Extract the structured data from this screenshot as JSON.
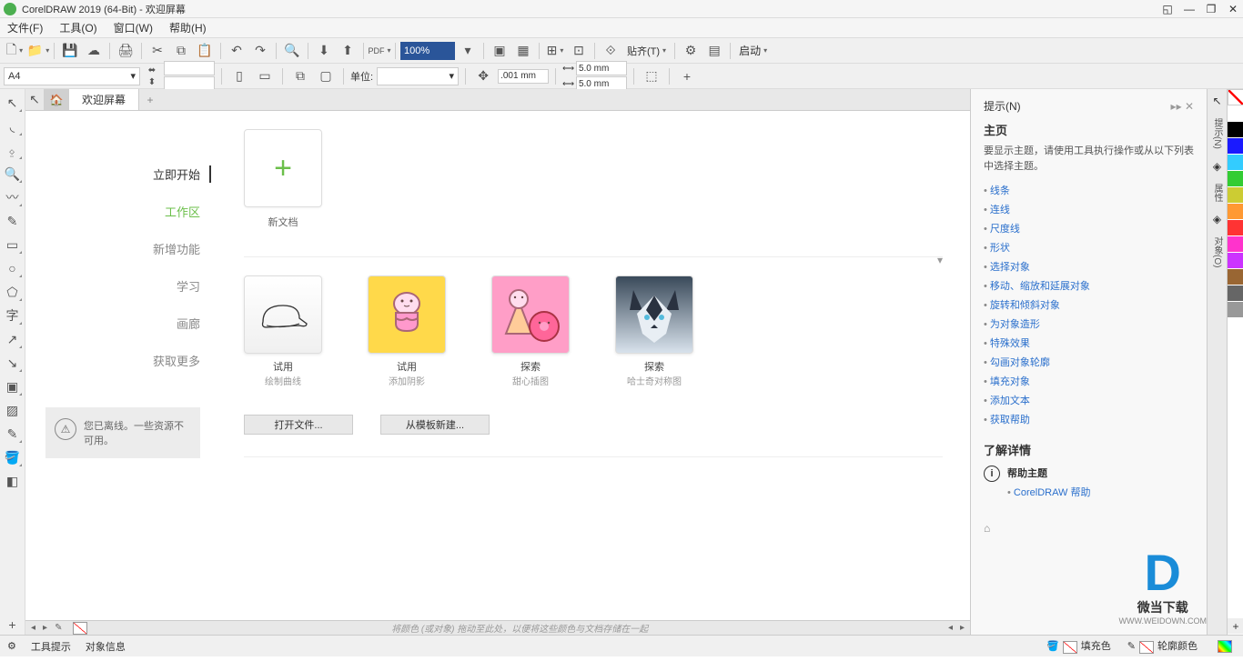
{
  "title": "CorelDRAW 2019 (64-Bit) - 欢迎屏幕",
  "menu": {
    "file": "文件(F)",
    "tools": "工具(O)",
    "window": "窗口(W)",
    "help": "帮助(H)"
  },
  "toolbar": {
    "zoom": "100%",
    "paste": "贴齐(T)",
    "launch": "启动"
  },
  "propbar": {
    "paper": "A4",
    "units": "单位:",
    "measure": ".001 mm",
    "nudge1": "5.0 mm",
    "nudge2": "5.0 mm"
  },
  "tabs": {
    "welcome": "欢迎屏幕"
  },
  "welcome": {
    "nav": {
      "start": "立即开始",
      "workspace": "工作区",
      "whatsnew": "新增功能",
      "learn": "学习",
      "gallery": "画廊",
      "getmore": "获取更多"
    },
    "offline": "您已离线。一些资源不可用。",
    "newdoc": "新文档",
    "thumbs": [
      {
        "t": "试用",
        "s": "绘制曲线"
      },
      {
        "t": "试用",
        "s": "添加阴影"
      },
      {
        "t": "探索",
        "s": "甜心插图"
      },
      {
        "t": "探索",
        "s": "哈士奇对称图"
      }
    ],
    "open": "打开文件...",
    "newtpl": "从模板新建...",
    "hint": "将颜色 (或对象) 拖动至此处，以便将这些颜色与文档存储在一起"
  },
  "hints": {
    "panel": "提示(N)",
    "title": "主页",
    "desc": "要显示主题，请使用工具执行操作或从以下列表中选择主题。",
    "links": [
      "线条",
      "连线",
      "尺度线",
      "形状",
      "选择对象",
      "移动、缩放和延展对象",
      "旋转和倾斜对象",
      "为对象造形",
      "特殊效果",
      "勾画对象轮廓",
      "填充对象",
      "添加文本",
      "获取帮助"
    ],
    "more": "了解详情",
    "helptopic": "帮助主题",
    "helplink": "CorelDRAW 帮助",
    "sidetabs": [
      "提示(N)",
      "属性",
      "对象(O)"
    ]
  },
  "status": {
    "tooltips": "工具提示",
    "objinfo": "对象信息",
    "fill": "填充色",
    "outline": "轮廓颜色"
  },
  "colors": [
    "#ffffff",
    "#000000",
    "#1a1aff",
    "#33ccff",
    "#33cc33",
    "#cccc33",
    "#ff9933",
    "#ff3333",
    "#ff33cc",
    "#cc33ff",
    "#996633",
    "#666666",
    "#999999"
  ],
  "watermark": {
    "logo": "D",
    "text": "微当下载",
    "url": "WWW.WEIDOWN.COM"
  }
}
